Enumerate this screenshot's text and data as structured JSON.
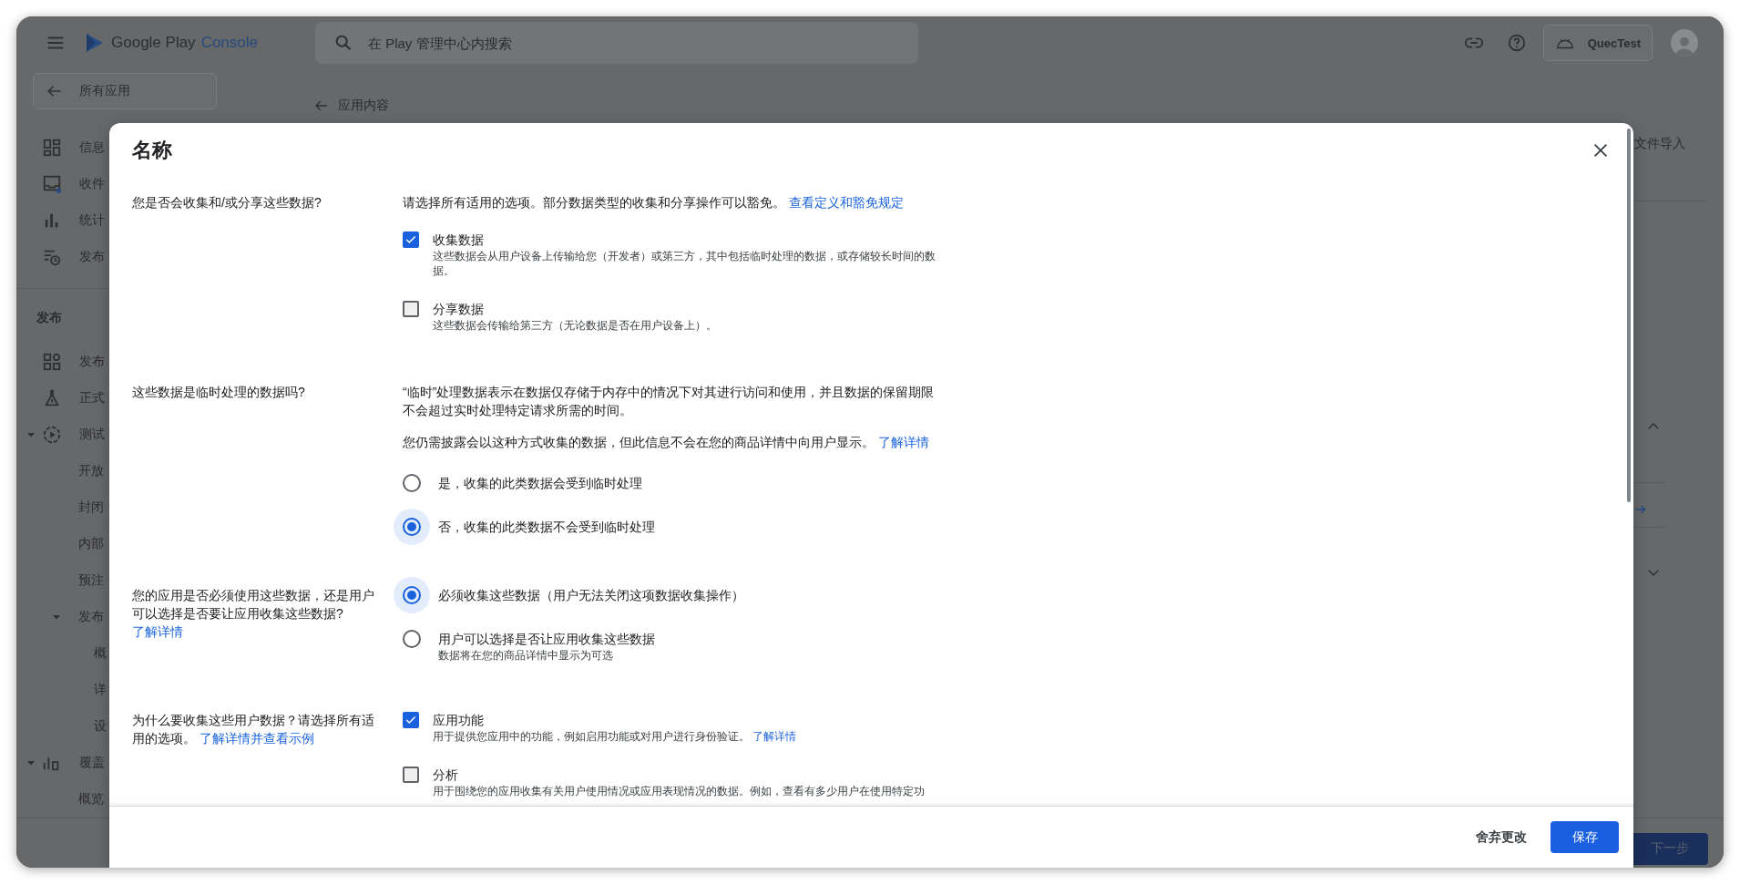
{
  "app_bar": {
    "brand": "Google Play",
    "product": "Console",
    "search": {
      "placeholder": "在 Play 管理中心内搜索"
    },
    "account": {
      "name": "QuecTest"
    }
  },
  "sidebar": {
    "back_label": "所有应用",
    "nav": [
      {
        "label": "信息"
      },
      {
        "label": "收件"
      },
      {
        "label": "统计"
      },
      {
        "label": "发布"
      }
    ],
    "sections": [
      {
        "heading": "发布",
        "items": [
          {
            "label": "发布"
          },
          {
            "label": "正式"
          },
          {
            "label": "测试",
            "expanded": true,
            "children": [
              {
                "label": "开放"
              },
              {
                "label": "封闭"
              },
              {
                "label": "内部"
              },
              {
                "label": "预注"
              },
              {
                "label": "发布",
                "expanded": true,
                "children": [
                  {
                    "label": "概"
                  },
                  {
                    "label": "详"
                  },
                  {
                    "label": "设"
                  }
                ]
              }
            ]
          },
          {
            "label": "覆盖",
            "expanded": true,
            "children": [
              {
                "label": "概览"
              }
            ]
          }
        ]
      }
    ]
  },
  "page": {
    "breadcrumb": "应用内容",
    "import_label": "文件导入",
    "next_button": "下一步"
  },
  "dialog": {
    "title": "名称",
    "questions": [
      {
        "question": "您是否会收集和/或分享这些数据?",
        "intro": [
          {
            "text": "请选择所有适用的选项。部分数据类型的收集和分享操作可以豁免。",
            "link": "查看定义和豁免规定"
          }
        ],
        "options": [
          {
            "kind": "checkbox",
            "label": "收集数据",
            "description": "这些数据会从用户设备上传输给您（开发者）或第三方，其中包括临时处理的数据，或存储较长时间的数据。",
            "checked": true
          },
          {
            "kind": "checkbox",
            "label": "分享数据",
            "description": "这些数据会传输给第三方（无论数据是否在用户设备上）。",
            "checked": false
          }
        ]
      },
      {
        "question": "这些数据是临时处理的数据吗?",
        "intro": [
          {
            "text": "“临时”处理数据表示在数据仅存储于内存中的情况下对其进行访问和使用，并且数据的保留期限不会超过实时处理特定请求所需的时间。"
          },
          {
            "text": "您仍需披露会以这种方式收集的数据，但此信息不会在您的商品详情中向用户显示。",
            "link": "了解详情"
          }
        ],
        "options": [
          {
            "kind": "radio",
            "label": "是，收集的此类数据会受到临时处理",
            "selected": false
          },
          {
            "kind": "radio",
            "label": "否，收集的此类数据不会受到临时处理",
            "selected": true
          }
        ]
      },
      {
        "question": "您的应用是否必须使用这些数据，还是用户可以选择是否要让应用收集这些数据?",
        "link": "了解详情",
        "options": [
          {
            "kind": "radio",
            "label": "必须收集这些数据（用户无法关闭这项数据收集操作）",
            "selected": true
          },
          {
            "kind": "radio",
            "label": "用户可以选择是否让应用收集这些数据",
            "description": "数据将在您的商品详情中显示为可选",
            "selected": false
          }
        ]
      },
      {
        "question": "为什么要收集这些用户数据？请选择所有适用的选项。",
        "link": "了解详情并查看示例",
        "options": [
          {
            "kind": "checkbox",
            "label": "应用功能",
            "description": "用于提供您应用中的功能，例如启用功能或对用户进行身份验证。",
            "description_link": "了解详情",
            "checked": true
          },
          {
            "kind": "checkbox",
            "label": "分析",
            "description": "用于围绕您的应用收集有关用户使用情况或应用表现情况的数据。例如，查看有多少用户在使用特定功",
            "checked": false
          }
        ]
      }
    ],
    "buttons": [
      {
        "kind": "text",
        "label": "舍弃更改"
      },
      {
        "kind": "primary",
        "label": "保存"
      }
    ]
  }
}
